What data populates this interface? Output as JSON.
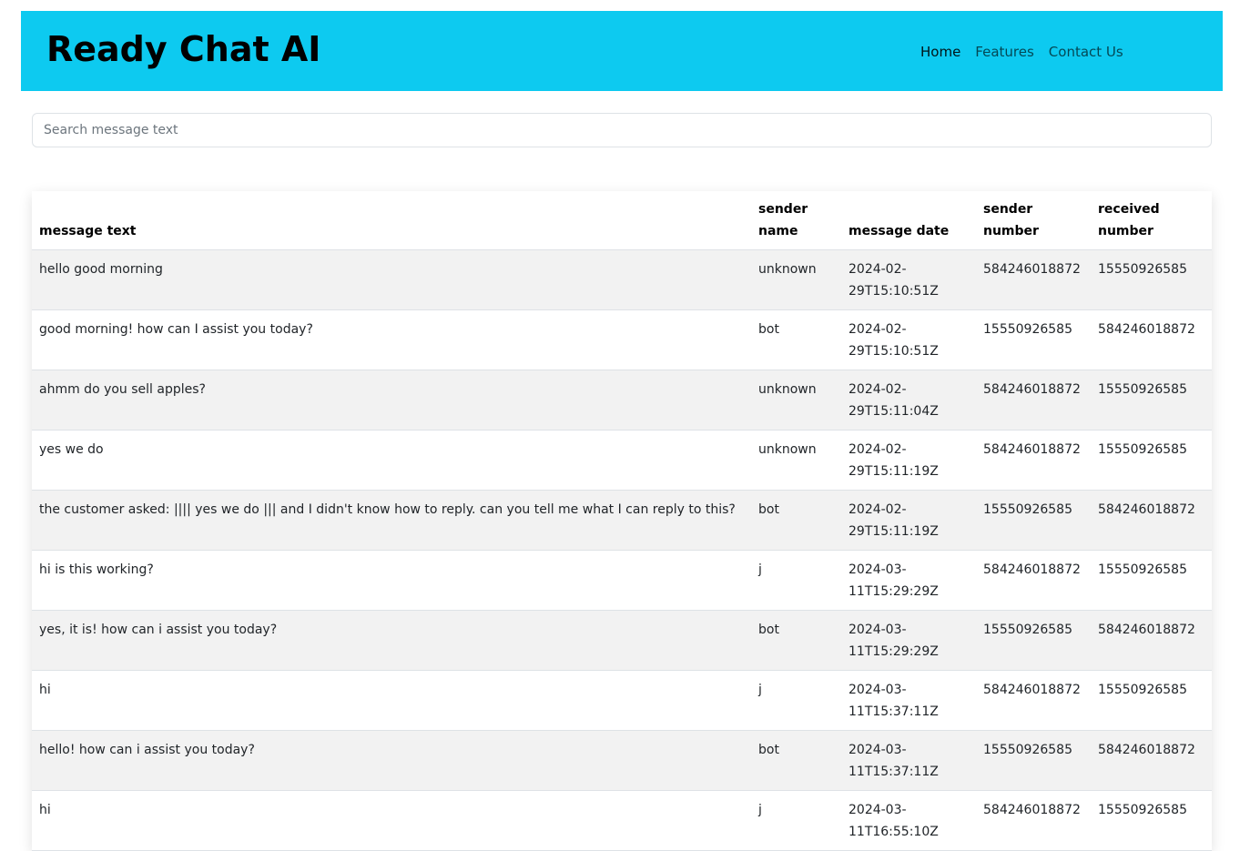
{
  "app": {
    "brand": "Ready Chat AI",
    "nav": [
      "Home",
      "Features",
      "Contact Us"
    ]
  },
  "search": {
    "placeholder": "Search message text",
    "value": ""
  },
  "table": {
    "headers": [
      "message text",
      "sender name",
      "message date",
      "sender number",
      "received number"
    ],
    "rows": [
      [
        "hello good morning",
        "unknown",
        "2024-02-29T15:10:51Z",
        "584246018872",
        "15550926585"
      ],
      [
        "good morning! how can I assist you today?",
        "bot",
        "2024-02-29T15:10:51Z",
        "15550926585",
        "584246018872"
      ],
      [
        "ahmm do you sell apples?",
        "unknown",
        "2024-02-29T15:11:04Z",
        "584246018872",
        "15550926585"
      ],
      [
        "yes we do",
        "unknown",
        "2024-02-29T15:11:19Z",
        "584246018872",
        "15550926585"
      ],
      [
        "the customer asked: |||| yes we do ||| and I didn't know how to reply. can you tell me what I can reply to this?",
        "bot",
        "2024-02-29T15:11:19Z",
        "15550926585",
        "584246018872"
      ],
      [
        "hi is this working?",
        "j",
        "2024-03-11T15:29:29Z",
        "584246018872",
        "15550926585"
      ],
      [
        "yes, it is! how can i assist you today?",
        "bot",
        "2024-03-11T15:29:29Z",
        "15550926585",
        "584246018872"
      ],
      [
        "hi",
        "j",
        "2024-03-11T15:37:11Z",
        "584246018872",
        "15550926585"
      ],
      [
        "hello! how can i assist you today?",
        "bot",
        "2024-03-11T15:37:11Z",
        "15550926585",
        "584246018872"
      ],
      [
        "hi",
        "j",
        "2024-03-11T16:55:10Z",
        "584246018872",
        "15550926585"
      ]
    ]
  },
  "colors": {
    "header_bg": "#0dcaf0",
    "row_striped": "#f2f2f2"
  }
}
